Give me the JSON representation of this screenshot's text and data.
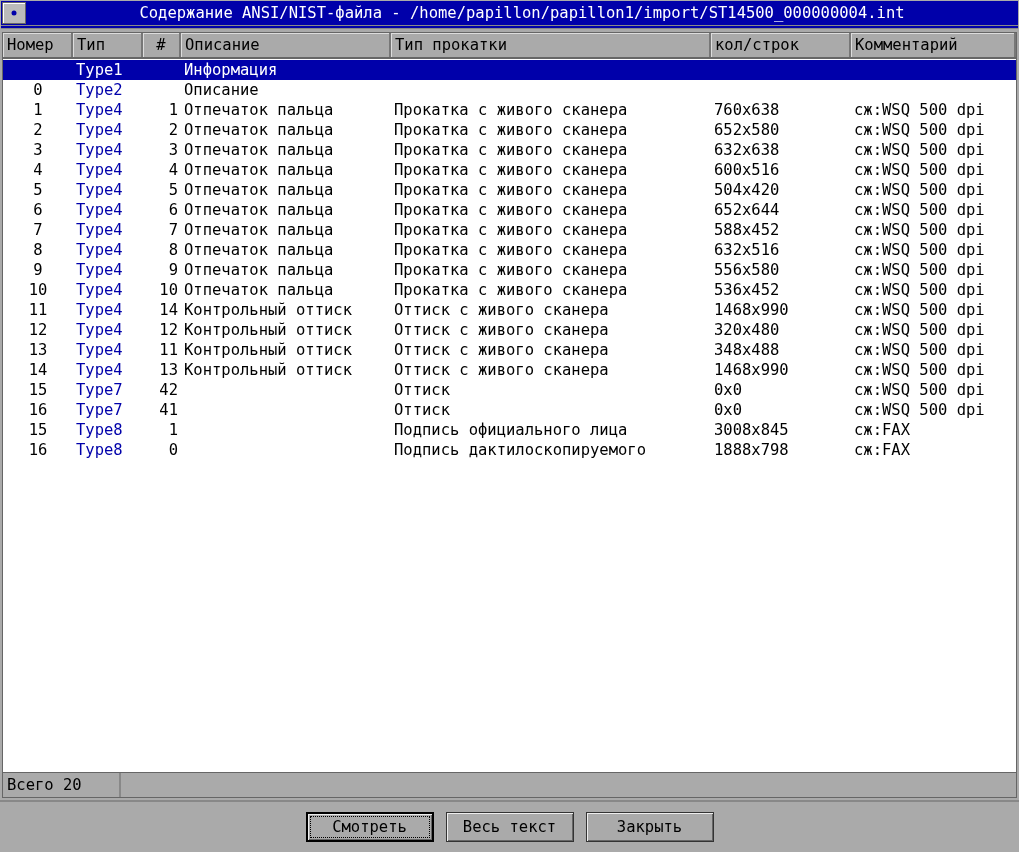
{
  "window": {
    "title": "Содержание ANSI/NIST-файла - /home/papillon/papillon1/import/ST14500_000000004.int"
  },
  "table": {
    "columns": [
      "Номер",
      "Тип",
      "#",
      "Описание",
      "Тип прокатки",
      "кол/строк",
      "Комментарий"
    ],
    "rows": [
      {
        "number": "",
        "type": "Type1",
        "index": "",
        "description": "Информация",
        "scan": "",
        "size": "",
        "comment": "",
        "selected": true
      },
      {
        "number": "0",
        "type": "Type2",
        "index": "",
        "description": "Описание",
        "scan": "",
        "size": "",
        "comment": "",
        "selected": false
      },
      {
        "number": "1",
        "type": "Type4",
        "index": "1",
        "description": "Отпечаток пальца",
        "scan": "Прокатка с живого сканера",
        "size": "760x638",
        "comment": "сж:WSQ 500 dpi",
        "selected": false
      },
      {
        "number": "2",
        "type": "Type4",
        "index": "2",
        "description": "Отпечаток пальца",
        "scan": "Прокатка с живого сканера",
        "size": "652x580",
        "comment": "сж:WSQ 500 dpi",
        "selected": false
      },
      {
        "number": "3",
        "type": "Type4",
        "index": "3",
        "description": "Отпечаток пальца",
        "scan": "Прокатка с живого сканера",
        "size": "632x638",
        "comment": "сж:WSQ 500 dpi",
        "selected": false
      },
      {
        "number": "4",
        "type": "Type4",
        "index": "4",
        "description": "Отпечаток пальца",
        "scan": "Прокатка с живого сканера",
        "size": "600x516",
        "comment": "сж:WSQ 500 dpi",
        "selected": false
      },
      {
        "number": "5",
        "type": "Type4",
        "index": "5",
        "description": "Отпечаток пальца",
        "scan": "Прокатка с живого сканера",
        "size": "504x420",
        "comment": "сж:WSQ 500 dpi",
        "selected": false
      },
      {
        "number": "6",
        "type": "Type4",
        "index": "6",
        "description": "Отпечаток пальца",
        "scan": "Прокатка с живого сканера",
        "size": "652x644",
        "comment": "сж:WSQ 500 dpi",
        "selected": false
      },
      {
        "number": "7",
        "type": "Type4",
        "index": "7",
        "description": "Отпечаток пальца",
        "scan": "Прокатка с живого сканера",
        "size": "588x452",
        "comment": "сж:WSQ 500 dpi",
        "selected": false
      },
      {
        "number": "8",
        "type": "Type4",
        "index": "8",
        "description": "Отпечаток пальца",
        "scan": "Прокатка с живого сканера",
        "size": "632x516",
        "comment": "сж:WSQ 500 dpi",
        "selected": false
      },
      {
        "number": "9",
        "type": "Type4",
        "index": "9",
        "description": "Отпечаток пальца",
        "scan": "Прокатка с живого сканера",
        "size": "556x580",
        "comment": "сж:WSQ 500 dpi",
        "selected": false
      },
      {
        "number": "10",
        "type": "Type4",
        "index": "10",
        "description": "Отпечаток пальца",
        "scan": "Прокатка с живого сканера",
        "size": "536x452",
        "comment": "сж:WSQ 500 dpi",
        "selected": false
      },
      {
        "number": "11",
        "type": "Type4",
        "index": "14",
        "description": "Контрольный оттиск",
        "scan": "Оттиск с живого сканера",
        "size": "1468x990",
        "comment": "сж:WSQ 500 dpi",
        "selected": false
      },
      {
        "number": "12",
        "type": "Type4",
        "index": "12",
        "description": "Контрольный оттиск",
        "scan": "Оттиск с живого сканера",
        "size": "320x480",
        "comment": "сж:WSQ 500 dpi",
        "selected": false
      },
      {
        "number": "13",
        "type": "Type4",
        "index": "11",
        "description": "Контрольный оттиск",
        "scan": "Оттиск с живого сканера",
        "size": "348x488",
        "comment": "сж:WSQ 500 dpi",
        "selected": false
      },
      {
        "number": "14",
        "type": "Type4",
        "index": "13",
        "description": "Контрольный оттиск",
        "scan": "Оттиск с живого сканера",
        "size": "1468x990",
        "comment": "сж:WSQ 500 dpi",
        "selected": false
      },
      {
        "number": "15",
        "type": "Type7",
        "index": "42",
        "description": "",
        "scan": "Оттиск",
        "size": "0x0",
        "comment": "сж:WSQ 500 dpi",
        "selected": false
      },
      {
        "number": "16",
        "type": "Type7",
        "index": "41",
        "description": "",
        "scan": "Оттиск",
        "size": "0x0",
        "comment": "сж:WSQ 500 dpi",
        "selected": false
      },
      {
        "number": "15",
        "type": "Type8",
        "index": "1",
        "description": "",
        "scan": "Подпись официального лица",
        "size": "3008x845",
        "comment": "сж:FAX",
        "selected": false
      },
      {
        "number": "16",
        "type": "Type8",
        "index": "0",
        "description": "",
        "scan": "Подпись дактилоскопируемого",
        "size": "1888x798",
        "comment": "сж:FAX",
        "selected": false
      }
    ]
  },
  "status_bar": {
    "text": "Всего 20"
  },
  "buttons": [
    {
      "label": "Смотреть",
      "selected": true
    },
    {
      "label": "Весь текст",
      "selected": false
    },
    {
      "label": "Закрыть",
      "selected": false
    }
  ]
}
